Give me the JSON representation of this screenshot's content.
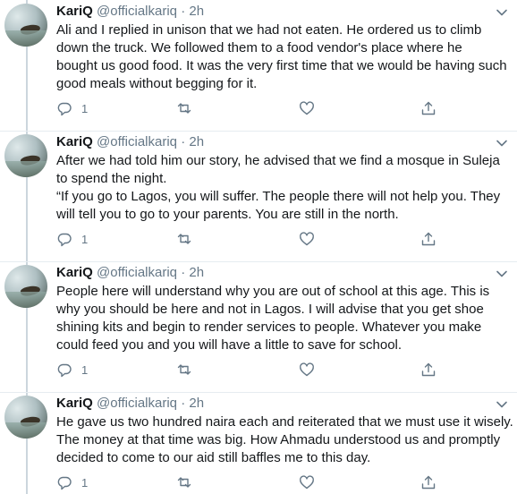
{
  "tweets": [
    {
      "name": "KariQ",
      "handle": "@officialkariq",
      "dot": "·",
      "time": "2h",
      "lines": [
        "Ali and I replied in unison that we had not eaten. He ordered us to climb",
        "down the truck. We followed them to a food vendor's place where he",
        "bought us good food. It was the very first time that we would be having such",
        "good meals without begging for it."
      ],
      "reply_count": "1"
    },
    {
      "name": "KariQ",
      "handle": "@officialkariq",
      "dot": "·",
      "time": "2h",
      "lines": [
        "After we had told him our story, he advised that we find a mosque in Suleja",
        "to spend the night.",
        "“If you go to Lagos, you will suffer. The people there will not help you. They",
        "will tell you to go to your parents. You are still in the north."
      ],
      "reply_count": "1"
    },
    {
      "name": "KariQ",
      "handle": "@officialkariq",
      "dot": "·",
      "time": "2h",
      "lines": [
        "People here will understand why you are out of school at this age. This is",
        "why you should be here and not in Lagos. I will advise that you get shoe",
        "shining kits and begin to render services to people. Whatever you make",
        "could feed you and you will have a little to save for school."
      ],
      "reply_count": "1"
    },
    {
      "name": "KariQ",
      "handle": "@officialkariq",
      "dot": "·",
      "time": "2h",
      "lines": [
        "He gave us two hundred naira each and reiterated that we must use it wisely.",
        "The money at that time was big. How Ahmadu understood us and promptly",
        "decided to come to our aid still baffles me to this day."
      ],
      "reply_count": "1"
    }
  ],
  "icons": {
    "reply": "reply-icon",
    "retweet": "retweet-icon",
    "like": "heart-icon",
    "share": "share-icon",
    "more": "chevron-down-icon"
  },
  "colors": {
    "text": "#14171a",
    "secondary": "#657786",
    "divider": "#e6ecf0",
    "thread_line": "#ccd6dd"
  }
}
